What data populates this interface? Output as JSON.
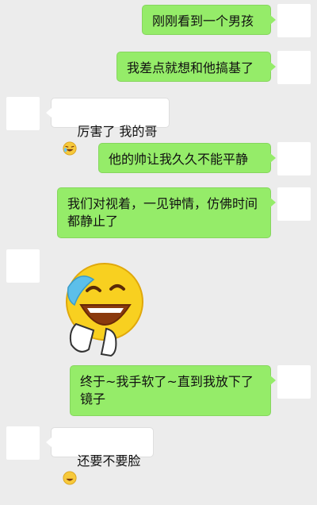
{
  "messages": [
    {
      "side": "out",
      "text": "刚刚看到一个男孩"
    },
    {
      "side": "out",
      "text": "我差点就想和他搞基了"
    },
    {
      "side": "in",
      "text": "厉害了 我的哥",
      "emoji": "laugh-emoji"
    },
    {
      "side": "out",
      "text": "他的帅让我久久不能平静"
    },
    {
      "side": "out",
      "text": "我们对视着，一见钟情，仿佛时间都静止了"
    },
    {
      "side": "in",
      "sticker": "laughing-face-sticker"
    },
    {
      "side": "out",
      "text": "终于~我手软了~直到我放下了镜子"
    },
    {
      "side": "in",
      "text": "还要不要脸",
      "emoji": "laugh-emoji"
    }
  ],
  "colors": {
    "background": "#ececec",
    "outgoing_bubble": "#95ec69",
    "incoming_bubble": "#ffffff"
  }
}
